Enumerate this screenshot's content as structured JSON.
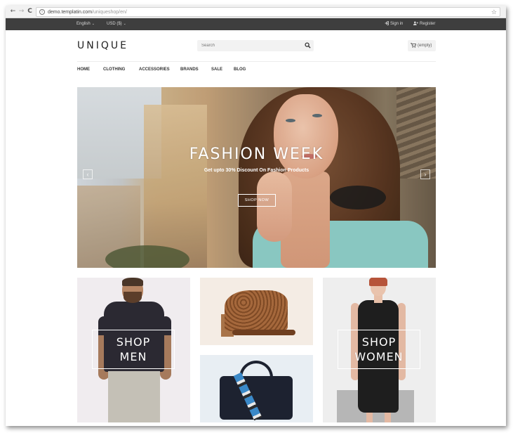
{
  "browser": {
    "url_host": "demo.templatin.com",
    "url_path": "/uniqueshop/en/",
    "back_icon": "←",
    "forward_icon": "→",
    "reload_icon": "C",
    "star_icon": "☆",
    "info_icon": "i"
  },
  "topbar": {
    "language": "English",
    "currency": "USD ($)",
    "signin": "Sign in",
    "register": "Register",
    "caret": "⌄"
  },
  "header": {
    "logo": "UNIQUE",
    "search_placeholder": "Search",
    "cart_label": "(empty)"
  },
  "menu": {
    "items": [
      "HOME",
      "CLOTHING",
      "ACCESSORIES",
      "BRANDS",
      "SALE",
      "BLOG"
    ]
  },
  "slider": {
    "title": "FASHION WEEK",
    "subtitle": "Get upto 30% Discount On Fashion Products",
    "button": "SHOP NOW",
    "prev": "‹",
    "next": "›"
  },
  "banners": {
    "men_line1": "SHOP",
    "men_line2": "MEN",
    "women_line1": "SHOP",
    "women_line2": "WOMEN"
  },
  "colors": {
    "topbar_bg": "#3e3e3e",
    "text_dark": "#333333",
    "search_bg": "#f2f2f2"
  }
}
